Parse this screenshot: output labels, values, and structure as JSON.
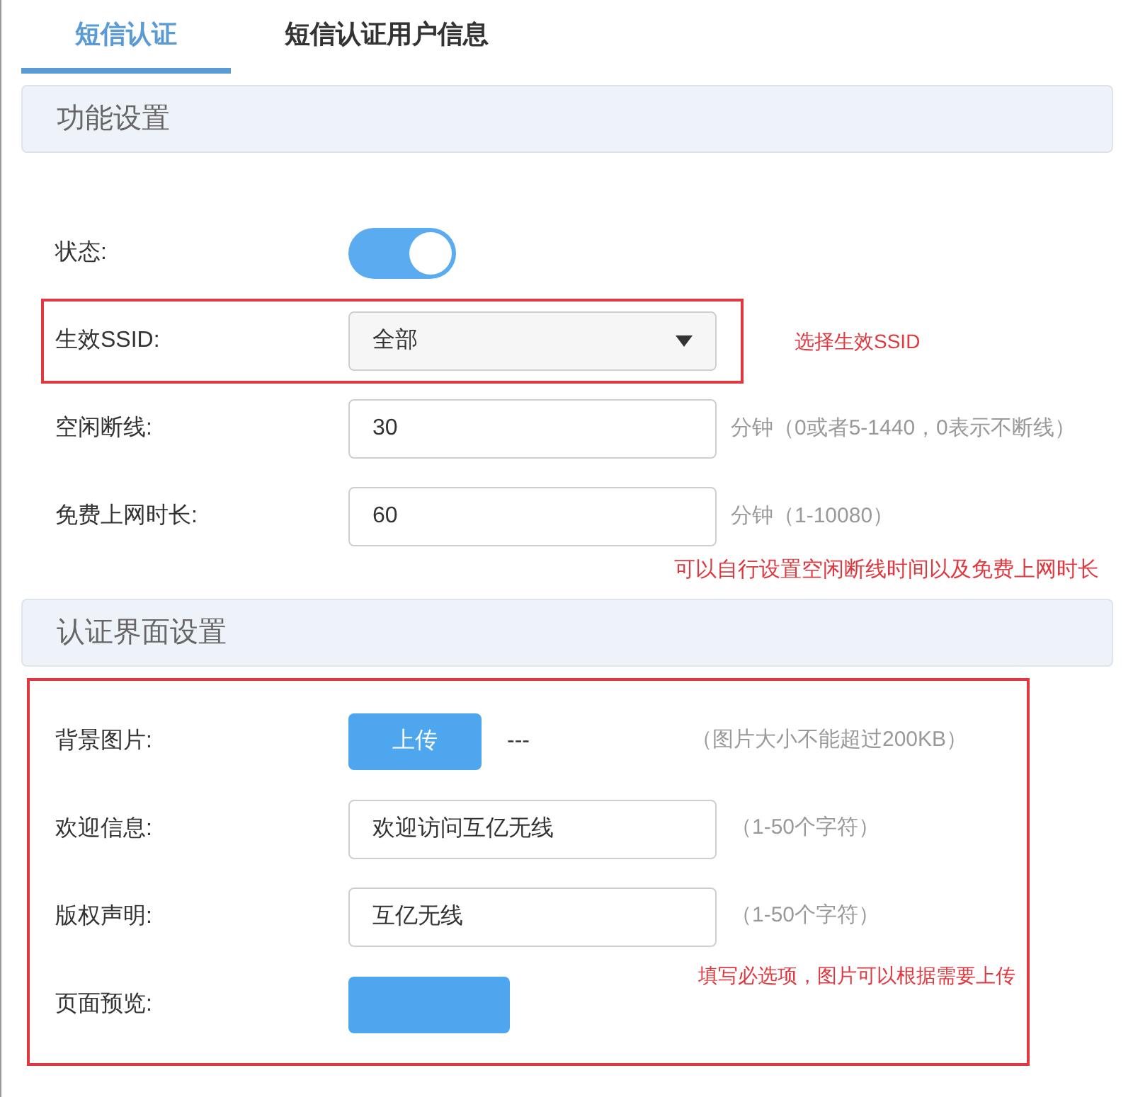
{
  "tabs": [
    {
      "label": "短信认证",
      "selected": true
    },
    {
      "label": "短信认证用户信息",
      "selected": false
    }
  ],
  "sections": [
    {
      "title": "功能设置",
      "highlighted": false,
      "rows": [
        {
          "kind": "toggle",
          "label": "状态:",
          "on": true
        },
        {
          "kind": "select",
          "label": "生效SSID:",
          "value": "全部",
          "highlighted": true,
          "note": "选择生效SSID"
        },
        {
          "kind": "input",
          "label": "空闲断线:",
          "value": "30",
          "hint": "分钟（0或者5-1440，0表示不断线）"
        },
        {
          "kind": "input",
          "label": "免费上网时长:",
          "value": "60",
          "hint": "分钟（1-10080）"
        }
      ],
      "note": "可以自行设置空闲断线时间以及免费上网时长"
    },
    {
      "title": "认证界面设置",
      "highlighted": true,
      "rows": [
        {
          "kind": "upload",
          "label": "背景图片:",
          "button": "上传",
          "value": "---",
          "hint": "（图片大小不能超过200KB）"
        },
        {
          "kind": "input",
          "label": "欢迎信息:",
          "value": "欢迎访问互亿无线",
          "hint": "（1-50个字符）"
        },
        {
          "kind": "input",
          "label": "版权声明:",
          "value": "互亿无线",
          "hint": "（1-50个字符）"
        },
        {
          "kind": "preview",
          "label": "页面预览:"
        }
      ],
      "note": "填写必选项，图片可以根据需要上传"
    }
  ]
}
